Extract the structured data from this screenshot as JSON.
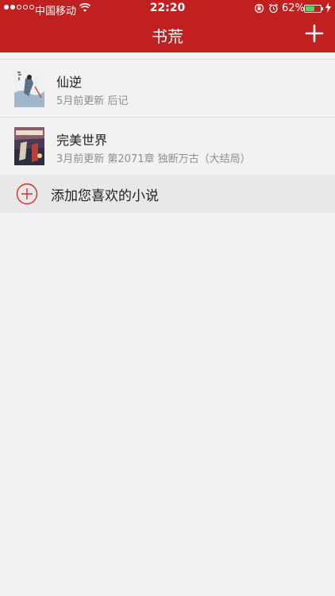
{
  "status_bar": {
    "carrier": "中国移动",
    "time": "22:20",
    "battery_percent": "62%",
    "battery_level": 0.62,
    "signal_bars_filled": 2,
    "signal_bars_total": 5
  },
  "nav": {
    "title": "书荒",
    "add_icon": "plus-icon"
  },
  "books": [
    {
      "title": "仙逆",
      "subtitle": "5月前更新 后记",
      "cover_icon": "book-cover"
    },
    {
      "title": "完美世界",
      "subtitle": "3月前更新 第2071章 独断万古（大结局）",
      "cover_icon": "book-cover"
    }
  ],
  "add_row": {
    "label": "添加您喜欢的小说",
    "icon": "plus-circle-icon"
  },
  "colors": {
    "header": "#c0201f",
    "accent": "#d32f2f",
    "background": "#f2f2f2",
    "battery": "#4cd964"
  }
}
